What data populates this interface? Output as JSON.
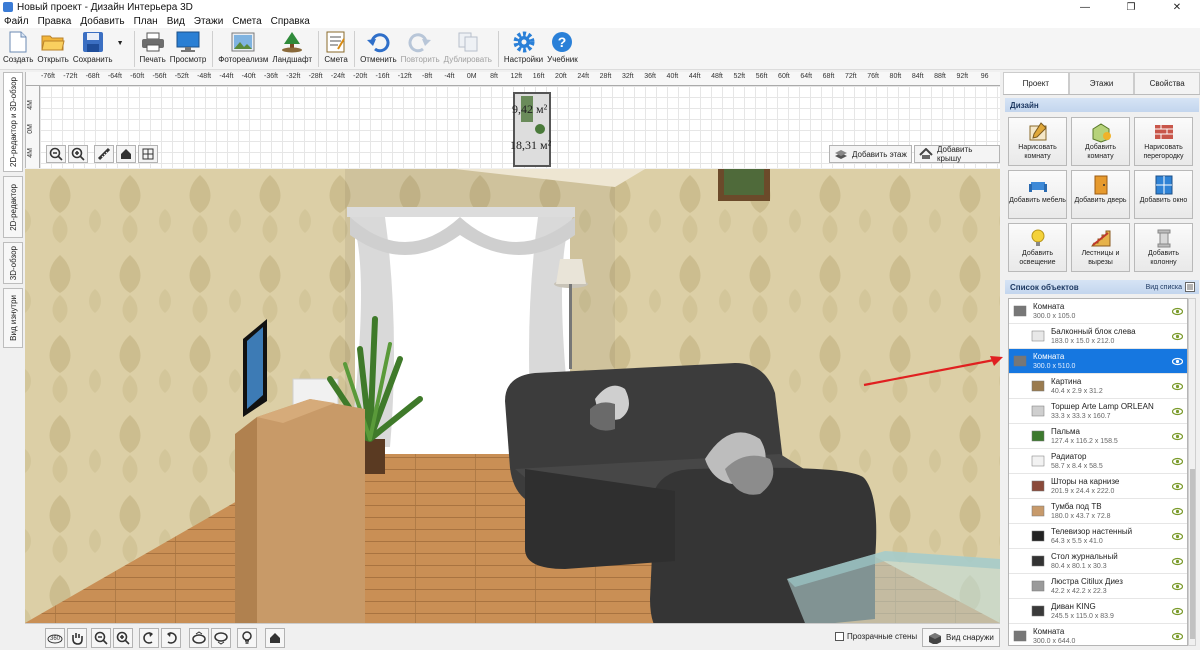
{
  "window": {
    "title": "Новый проект - Дизайн Интерьера 3D",
    "minimize": "—",
    "maximize": "❐",
    "close": "✕"
  },
  "menu": [
    "Файл",
    "Правка",
    "Добавить",
    "План",
    "Вид",
    "Этажи",
    "Смета",
    "Справка"
  ],
  "toolbar": {
    "create": "Создать",
    "open": "Открыть",
    "save": "Сохранить",
    "print": "Печать",
    "preview": "Просмотр",
    "photo": "Фотореализм",
    "landscape": "Ландшафт",
    "estimate": "Смета",
    "undo": "Отменить",
    "redo": "Повторить",
    "duplicate": "Дублировать",
    "settings": "Настройки",
    "tutorial": "Учебник"
  },
  "left_tabs": [
    "2D-редактор и 3D-обзор",
    "2D-редактор",
    "3D-обзор",
    "Вид изнутри"
  ],
  "plan": {
    "ruler_top": [
      "-76ft",
      "-72ft",
      "-68ft",
      "-64ft",
      "-60ft",
      "-56ft",
      "-52ft",
      "-48ft",
      "-44ft",
      "-40ft",
      "-36ft",
      "-32ft",
      "-28ft",
      "-24ft",
      "-20ft",
      "-16ft",
      "-12ft",
      "-8ft",
      "-4ft",
      "0M",
      "8ft",
      "12ft",
      "16ft",
      "20ft",
      "24ft",
      "28ft",
      "32ft",
      "36ft",
      "40ft",
      "44ft",
      "48ft",
      "52ft",
      "56ft",
      "60ft",
      "64ft",
      "68ft",
      "72ft",
      "76ft",
      "80ft",
      "84ft",
      "88ft",
      "92ft",
      "96"
    ],
    "ruler_left": [
      "4M",
      "0M",
      "4M"
    ],
    "area1": "9,42 м²",
    "area2": "18,31 м²",
    "add_floor": "Добавить этаж",
    "add_roof": "Добавить крышу"
  },
  "bottom": {
    "transparent_walls": "Прозрачные стены",
    "outside_view": "Вид снаружи"
  },
  "right_panel": {
    "tabs": [
      "Проект",
      "Этажи",
      "Свойства"
    ],
    "design_header": "Дизайн",
    "design_buttons": [
      {
        "label": "Нарисовать комнату",
        "icon": "draw-room-icon"
      },
      {
        "label": "Добавить комнату",
        "icon": "add-room-icon"
      },
      {
        "label": "Нарисовать перегородку",
        "icon": "draw-partition-icon"
      },
      {
        "label": "Добавить мебель",
        "icon": "add-furniture-icon"
      },
      {
        "label": "Добавить дверь",
        "icon": "add-door-icon"
      },
      {
        "label": "Добавить окно",
        "icon": "add-window-icon"
      },
      {
        "label": "Добавить освещение",
        "icon": "add-lighting-icon"
      },
      {
        "label": "Лестницы и вырезы",
        "icon": "stairs-icon"
      },
      {
        "label": "Добавить колонну",
        "icon": "add-column-icon"
      }
    ],
    "objects_header": "Список объектов",
    "view_list": "Вид списка",
    "objects": [
      {
        "name": "Комната",
        "dims": "300.0 x 105.0",
        "indent": false,
        "selected": false,
        "thumb": "#777777"
      },
      {
        "name": "Балконный блок слева",
        "dims": "183.0 x 15.0 x 212.0",
        "indent": true,
        "selected": false,
        "thumb": "#e8e8e8"
      },
      {
        "name": "Комната",
        "dims": "300.0 x 510.0",
        "indent": false,
        "selected": true,
        "thumb": "#777777"
      },
      {
        "name": "Картина",
        "dims": "40.4 x 2.9 x 31.2",
        "indent": true,
        "selected": false,
        "thumb": "#9a7b4f"
      },
      {
        "name": "Торшер Arte Lamp ORLEAN",
        "dims": "33.3 x 33.3 x 160.7",
        "indent": true,
        "selected": false,
        "thumb": "#cfcfcf"
      },
      {
        "name": "Пальма",
        "dims": "127.4 x 116.2 x 158.5",
        "indent": true,
        "selected": false,
        "thumb": "#3d7a2e"
      },
      {
        "name": "Радиатор",
        "dims": "58.7 x 8.4 x 58.5",
        "indent": true,
        "selected": false,
        "thumb": "#f2f2f2"
      },
      {
        "name": "Шторы на карнизе",
        "dims": "201.9 x 24.4 x 222.0",
        "indent": true,
        "selected": false,
        "thumb": "#8a4a3a"
      },
      {
        "name": "Тумба под ТВ",
        "dims": "180.0 x 43.7 x 72.8",
        "indent": true,
        "selected": false,
        "thumb": "#c79a6b"
      },
      {
        "name": "Телевизор настенный",
        "dims": "64.3 x 5.5 x 41.0",
        "indent": true,
        "selected": false,
        "thumb": "#222222"
      },
      {
        "name": "Стол журнальный",
        "dims": "80.4 x 80.1 x 30.3",
        "indent": true,
        "selected": false,
        "thumb": "#333333"
      },
      {
        "name": "Люстра Citilux Диез",
        "dims": "42.2 x 42.2 x 22.3",
        "indent": true,
        "selected": false,
        "thumb": "#9a9a9a"
      },
      {
        "name": "Диван KING",
        "dims": "245.5 x 115.0 x 83.9",
        "indent": true,
        "selected": false,
        "thumb": "#3a3a3a"
      },
      {
        "name": "Комната",
        "dims": "300.0 x 644.0",
        "indent": false,
        "selected": false,
        "thumb": "#777777"
      }
    ]
  },
  "colors": {
    "accent": "#1677e0",
    "section_header": "#1f3a63",
    "arrow": "#e02020",
    "wall": "#d8c9a0",
    "floor": "#c8915a"
  }
}
